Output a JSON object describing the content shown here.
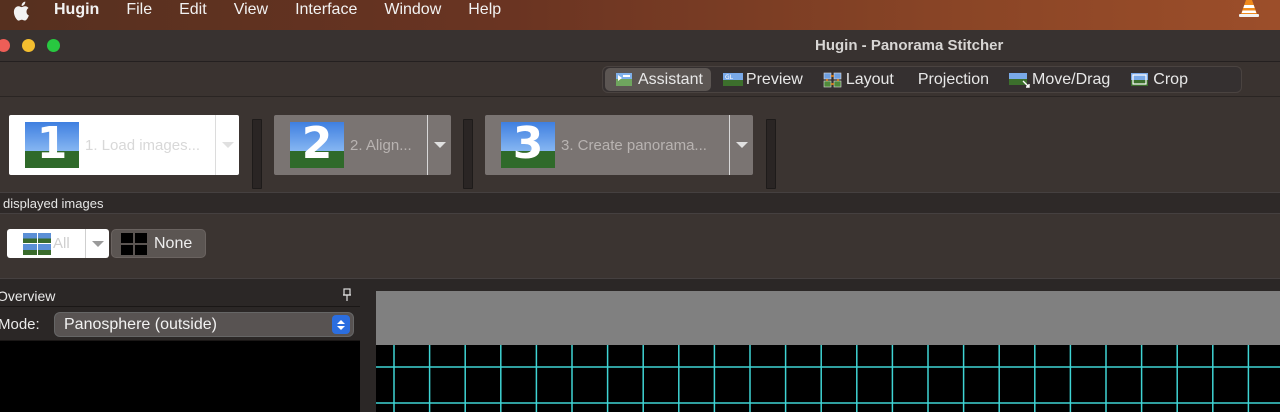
{
  "menubar": {
    "app": "Hugin",
    "items": [
      "File",
      "Edit",
      "View",
      "Interface",
      "Window",
      "Help"
    ]
  },
  "window": {
    "title": "Hugin - Panorama Stitcher"
  },
  "tabs": [
    {
      "label": "Assistant",
      "icon": "assistant-icon",
      "active": true
    },
    {
      "label": "Preview",
      "icon": "preview-icon",
      "active": false
    },
    {
      "label": "Layout",
      "icon": "layout-icon",
      "active": false
    },
    {
      "label": "Projection",
      "icon": "",
      "active": false
    },
    {
      "label": "Move/Drag",
      "icon": "move-drag-icon",
      "active": false
    },
    {
      "label": "Crop",
      "icon": "crop-icon",
      "active": false
    }
  ],
  "steps": [
    {
      "number": "1",
      "label": "1. Load images...",
      "enabled": true
    },
    {
      "number": "2",
      "label": "2. Align...",
      "enabled": false
    },
    {
      "number": "3",
      "label": "3. Create panorama...",
      "enabled": false
    }
  ],
  "displayed_images": {
    "section_label": "displayed images",
    "all_label": "All",
    "none_label": "None"
  },
  "overview": {
    "title": "Overview",
    "mode_label": "Mode:",
    "mode_value": "Panosphere (outside)"
  },
  "colors": {
    "grid_line": "#3fd4d4",
    "preview_gray": "#808080",
    "accent_blue": "#2b6ee0"
  }
}
